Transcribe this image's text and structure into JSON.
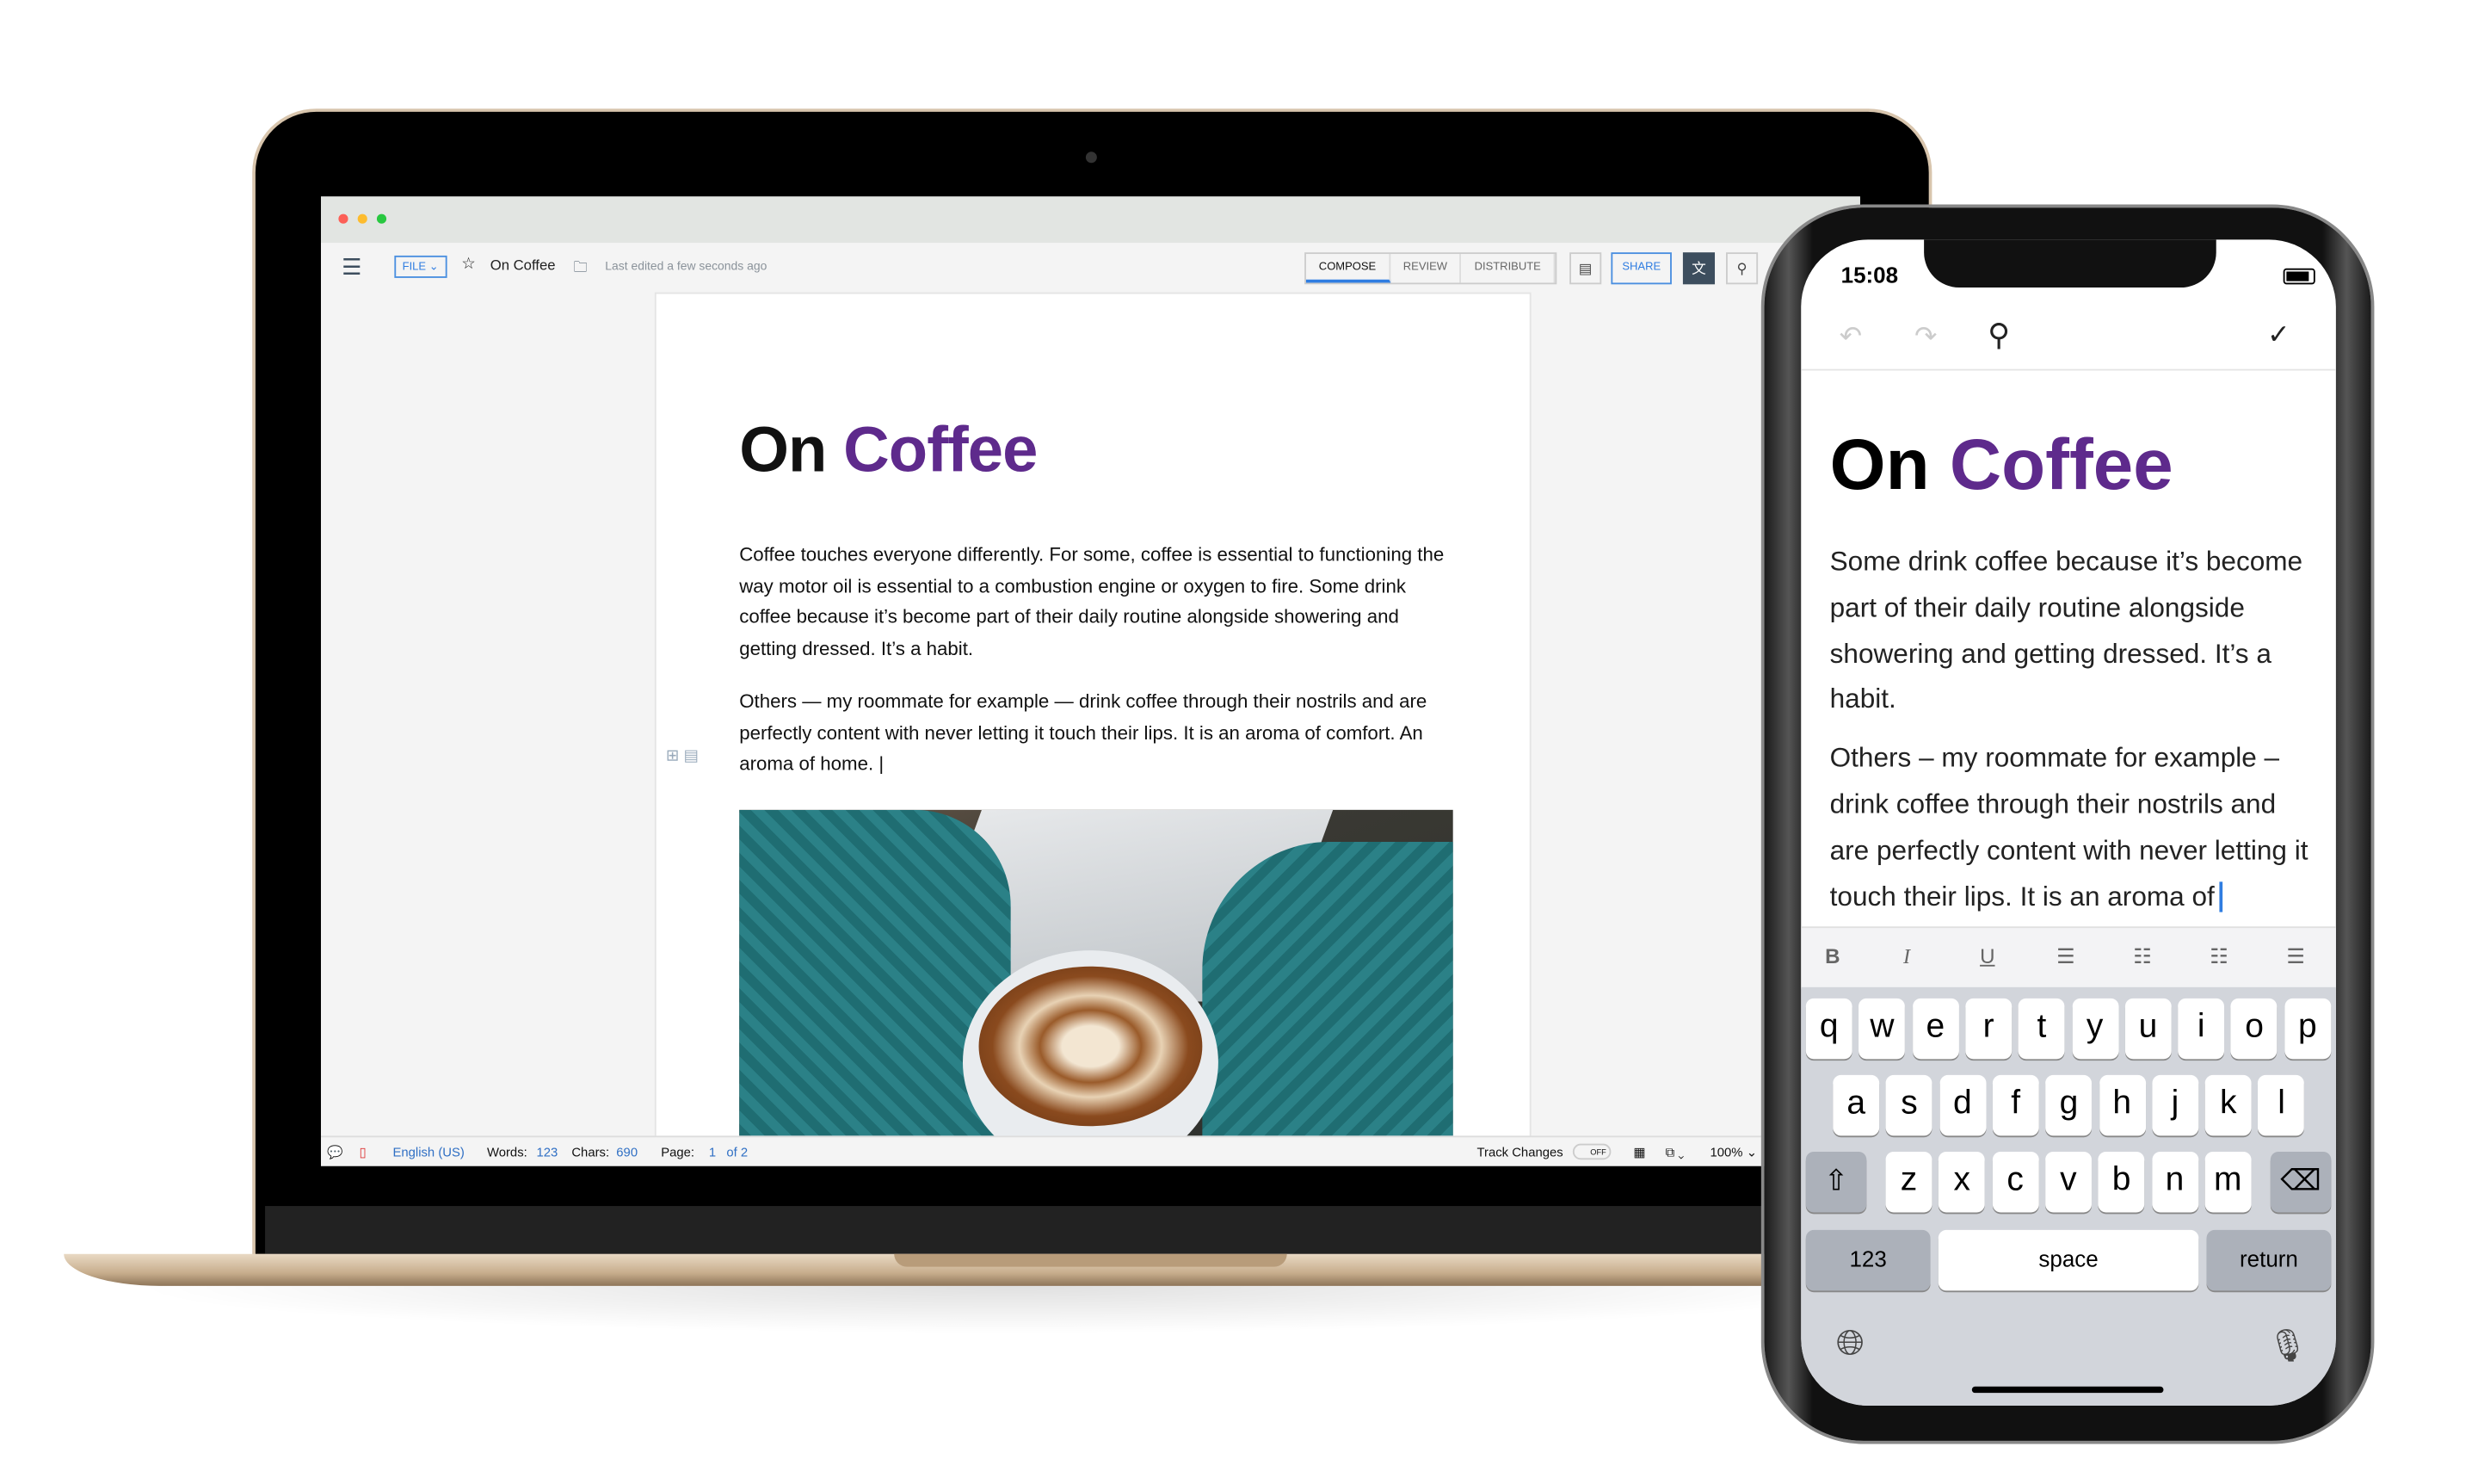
{
  "desktop": {
    "menu_icon": "hamburger-icon",
    "file_label": "FILE",
    "doc_name": "On Coffee",
    "last_edited": "Last edited a few seconds ago",
    "tabs": [
      {
        "label": "COMPOSE",
        "active": true
      },
      {
        "label": "REVIEW"
      },
      {
        "label": "DISTRIBUTE"
      }
    ],
    "share_label": "SHARE",
    "document": {
      "title_word1": "On",
      "title_word2": "Coffee",
      "paragraphs": [
        "Coffee touches everyone differently. For some, coffee is essential to functioning the way motor oil is essential to a combustion engine or oxygen to fire. Some drink coffee because it’s become part of their daily routine alongside showering and getting dressed. It’s a habit.",
        "Others — my roommate for example — drink coffee through their nostrils and are perfectly content with never letting it touch their lips. It is an aroma of comfort. An aroma of home. |"
      ]
    },
    "status": {
      "language": "English (US)",
      "words_label": "Words:",
      "words": "123",
      "chars_label": "Chars:",
      "chars": "690",
      "page_label": "Page:",
      "page": "1",
      "page_of": "of 2",
      "track_changes": "Track Changes",
      "track_state": "OFF",
      "zoom": "100%"
    }
  },
  "phone": {
    "time": "15:08",
    "title_word1": "On",
    "title_word2": "Coffee",
    "paragraphs": [
      "Some drink coffee because it’s become part of their daily routine alongside showering and getting dressed. It’s a habit.",
      "Others – my roommate for example – drink coffee through their nostrils and are perfectly content with never letting it touch their lips. It is an aroma of"
    ],
    "format": {
      "bold": "B",
      "italic": "I",
      "underline": "U"
    },
    "keyboard": {
      "row1": [
        "q",
        "w",
        "e",
        "r",
        "t",
        "y",
        "u",
        "i",
        "o",
        "p"
      ],
      "row2": [
        "a",
        "s",
        "d",
        "f",
        "g",
        "h",
        "j",
        "k",
        "l"
      ],
      "row3": [
        "z",
        "x",
        "c",
        "v",
        "b",
        "n",
        "m"
      ],
      "numbers": "123",
      "space": "space",
      "return": "return"
    }
  },
  "colors": {
    "accent": "#2f7de1",
    "title_purple": "#5e2a8c",
    "toolbar_dark": "#3d4e5e"
  }
}
